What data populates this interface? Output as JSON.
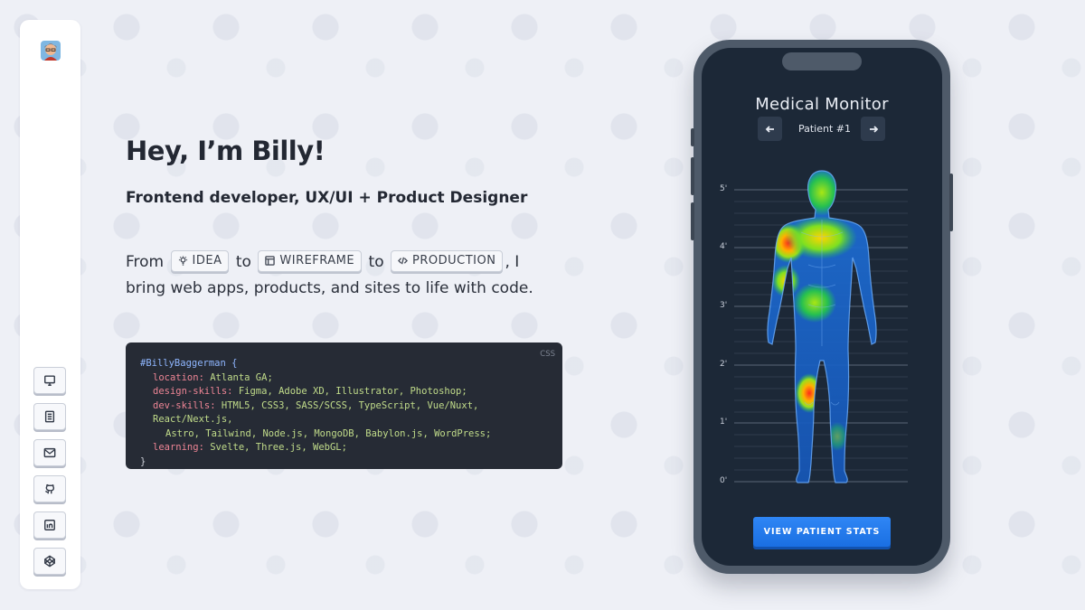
{
  "sidebar": {
    "buttons": [
      {
        "name": "monitor-icon"
      },
      {
        "name": "document-icon"
      },
      {
        "name": "mail-icon"
      },
      {
        "name": "github-icon"
      },
      {
        "name": "linkedin-icon"
      },
      {
        "name": "codepen-icon"
      }
    ]
  },
  "hero": {
    "title": "Hey, I’m Billy!",
    "subtitle": "Frontend developer, UX/UI + Product Designer",
    "desc_from": "From",
    "pill_idea": "IDEA",
    "desc_to1": "to",
    "pill_wireframe": "WIREFRAME",
    "desc_to2": "to",
    "pill_production": "PRODUCTION",
    "desc_rest": ", I bring web apps, products, and sites to life with code."
  },
  "code": {
    "lang": "CSS",
    "selector": "#BillyBaggerman {",
    "lines": [
      {
        "prop": "location:",
        "val": "Atlanta GA;"
      },
      {
        "prop": "design-skills:",
        "val": "Figma, Adobe XD, Illustrator, Photoshop;"
      },
      {
        "prop": "dev-skills:",
        "val": "HTML5, CSS3, SASS/SCSS, TypeScript, Vue/Nuxt, React/Next.js,"
      },
      {
        "prop": "",
        "val": "Astro, Tailwind, Node.js, MongoDB, Babylon.js, WordPress;"
      },
      {
        "prop": "learning:",
        "val": "Svelte, Three.js, WebGL;"
      }
    ],
    "close": "}"
  },
  "phone": {
    "title": "Medical Monitor",
    "patient": "Patient #1",
    "scale": [
      "5'",
      "4'",
      "3'",
      "2'",
      "1'",
      "0'"
    ],
    "button": "VIEW PATIENT STATS",
    "colors": {
      "accent": "#2378eb",
      "screen": "#1c2837",
      "frame": "#4e5a69"
    }
  }
}
